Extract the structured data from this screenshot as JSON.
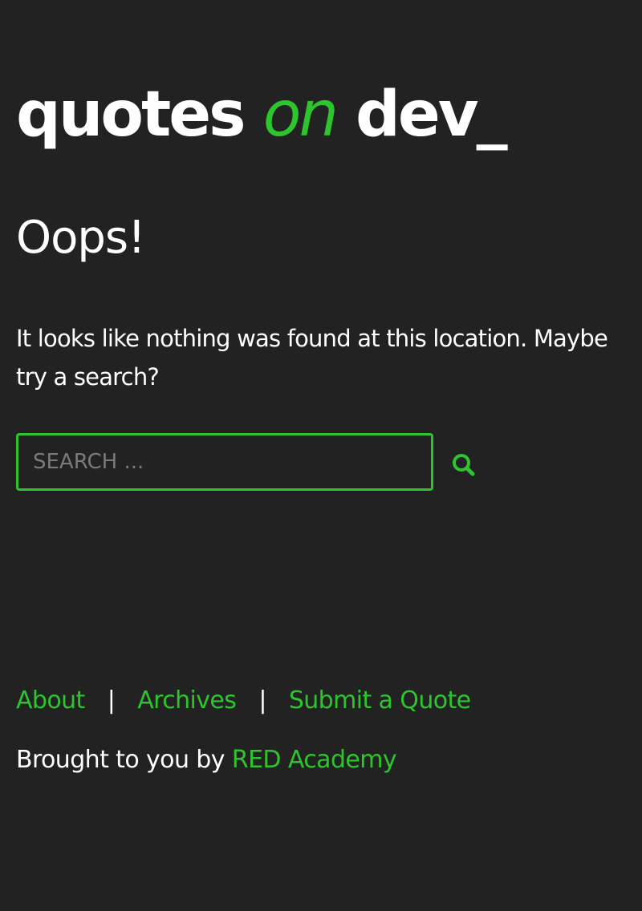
{
  "site": {
    "title_part1": "quotes ",
    "title_accent": "on",
    "title_part2": " dev_"
  },
  "page": {
    "title": "Oops!",
    "message": "It looks like nothing was found at this location. Maybe try a search?"
  },
  "search": {
    "placeholder": "SEARCH ...",
    "value": "",
    "button_icon": "search-icon"
  },
  "footer": {
    "nav": [
      "About",
      "Archives",
      "Submit a Quote"
    ],
    "separator": "|",
    "credit_prefix": "Brought to you by ",
    "credit_link": "RED Academy"
  },
  "colors": {
    "background": "#222222",
    "accent": "#2ec42e",
    "text": "#ffffff",
    "placeholder": "#7a7a7a"
  }
}
